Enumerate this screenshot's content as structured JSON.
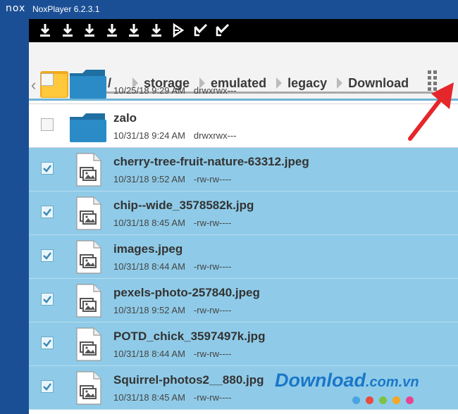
{
  "window": {
    "logo": "nox",
    "title": "NoxPlayer 6.2.3.1"
  },
  "notification_icons": [
    "download-icon",
    "download-icon",
    "download-icon",
    "download-icon",
    "download-icon",
    "download-icon",
    "play-store-icon",
    "checkmark-icon",
    "checkmark-icon"
  ],
  "toolbar": {
    "breadcrumbs": [
      {
        "label": "/"
      },
      {
        "label": "storage"
      },
      {
        "label": "emulated"
      },
      {
        "label": "legacy"
      },
      {
        "label": "Download"
      }
    ]
  },
  "files": [
    {
      "name": "",
      "date": "10/25/18 9:29 AM",
      "perm": "drwxrwx---",
      "type": "folder",
      "selected": false
    },
    {
      "name": "zalo",
      "date": "10/31/18 9:24 AM",
      "perm": "drwxrwx---",
      "type": "folder",
      "selected": false
    },
    {
      "name": "cherry-tree-fruit-nature-63312.jpeg",
      "date": "10/31/18 9:52 AM",
      "perm": "-rw-rw----",
      "type": "image",
      "selected": true
    },
    {
      "name": "chip--wide_3578582k.jpg",
      "date": "10/31/18 8:45 AM",
      "perm": "-rw-rw----",
      "type": "image",
      "selected": true
    },
    {
      "name": "images.jpeg",
      "date": "10/31/18 8:44 AM",
      "perm": "-rw-rw----",
      "type": "image",
      "selected": true
    },
    {
      "name": "pexels-photo-257840.jpeg",
      "date": "10/31/18 9:52 AM",
      "perm": "-rw-rw----",
      "type": "image",
      "selected": true
    },
    {
      "name": "POTD_chick_3597497k.jpg",
      "date": "10/31/18 8:44 AM",
      "perm": "-rw-rw----",
      "type": "image",
      "selected": true
    },
    {
      "name": "Squirrel-photos2__880.jpg",
      "date": "10/31/18 8:45 AM",
      "perm": "-rw-rw----",
      "type": "image",
      "selected": true
    }
  ],
  "watermark": {
    "text_main": "Download",
    "text_suffix": ".com.vn",
    "dot_colors": [
      "#4aa3df",
      "#e94b3c",
      "#7cc242",
      "#f5a623",
      "#e84393"
    ]
  },
  "colors": {
    "title_bar": "#1b4f95",
    "selected_row": "#8fcbe8",
    "accent_line": "#6fb4d6",
    "arrow": "#e5262b"
  }
}
